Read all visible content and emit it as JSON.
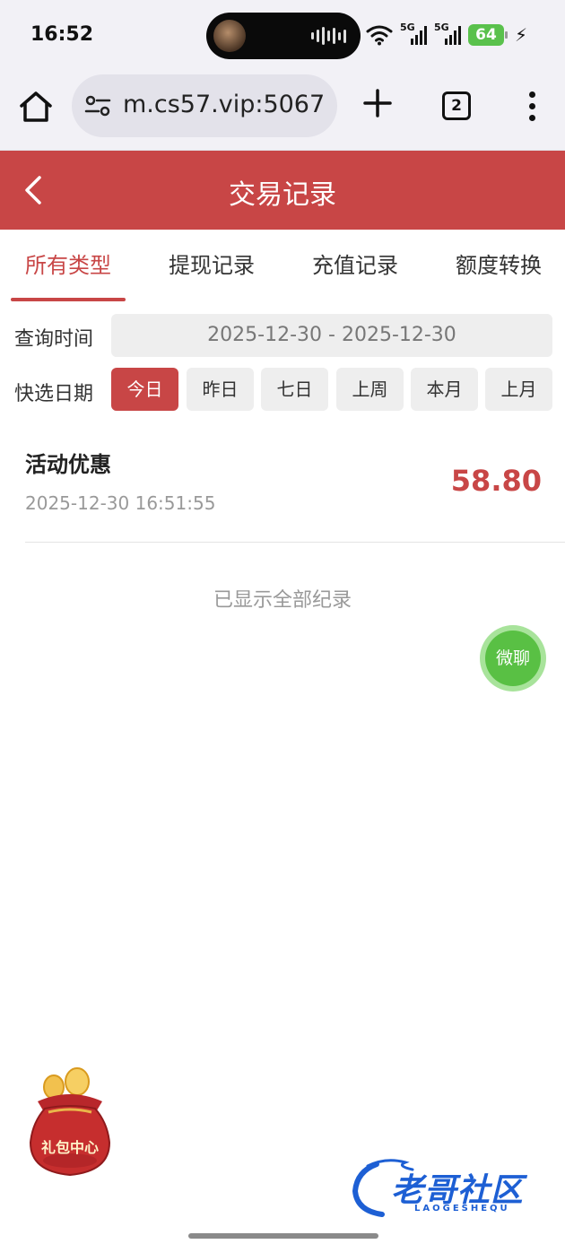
{
  "status_bar": {
    "time": "16:52",
    "network_1": "5G",
    "network_2": "5G",
    "battery": "64"
  },
  "browser": {
    "url": "m.cs57.vip:5067",
    "tab_count": "2"
  },
  "header": {
    "title": "交易记录"
  },
  "tabs": [
    {
      "label": "所有类型"
    },
    {
      "label": "提现记录"
    },
    {
      "label": "充值记录"
    },
    {
      "label": "额度转换"
    }
  ],
  "filters": {
    "query_time_label": "查询时间",
    "date_range": "2025-12-30 - 2025-12-30",
    "quick_select_label": "快选日期",
    "quick_options": [
      "今日",
      "昨日",
      "七日",
      "上周",
      "本月",
      "上月"
    ]
  },
  "records": [
    {
      "title": "活动优惠",
      "time": "2025-12-30 16:51:55",
      "amount": "58.80"
    }
  ],
  "end_text": "已显示全部纪录",
  "chat_float": "微聊",
  "gift_bag": "礼包中心",
  "watermark": {
    "text": "老哥社区",
    "sub": "LAOGESHEQU"
  },
  "colors": {
    "brand_red": "#c84646",
    "chat_green": "#59c044"
  }
}
